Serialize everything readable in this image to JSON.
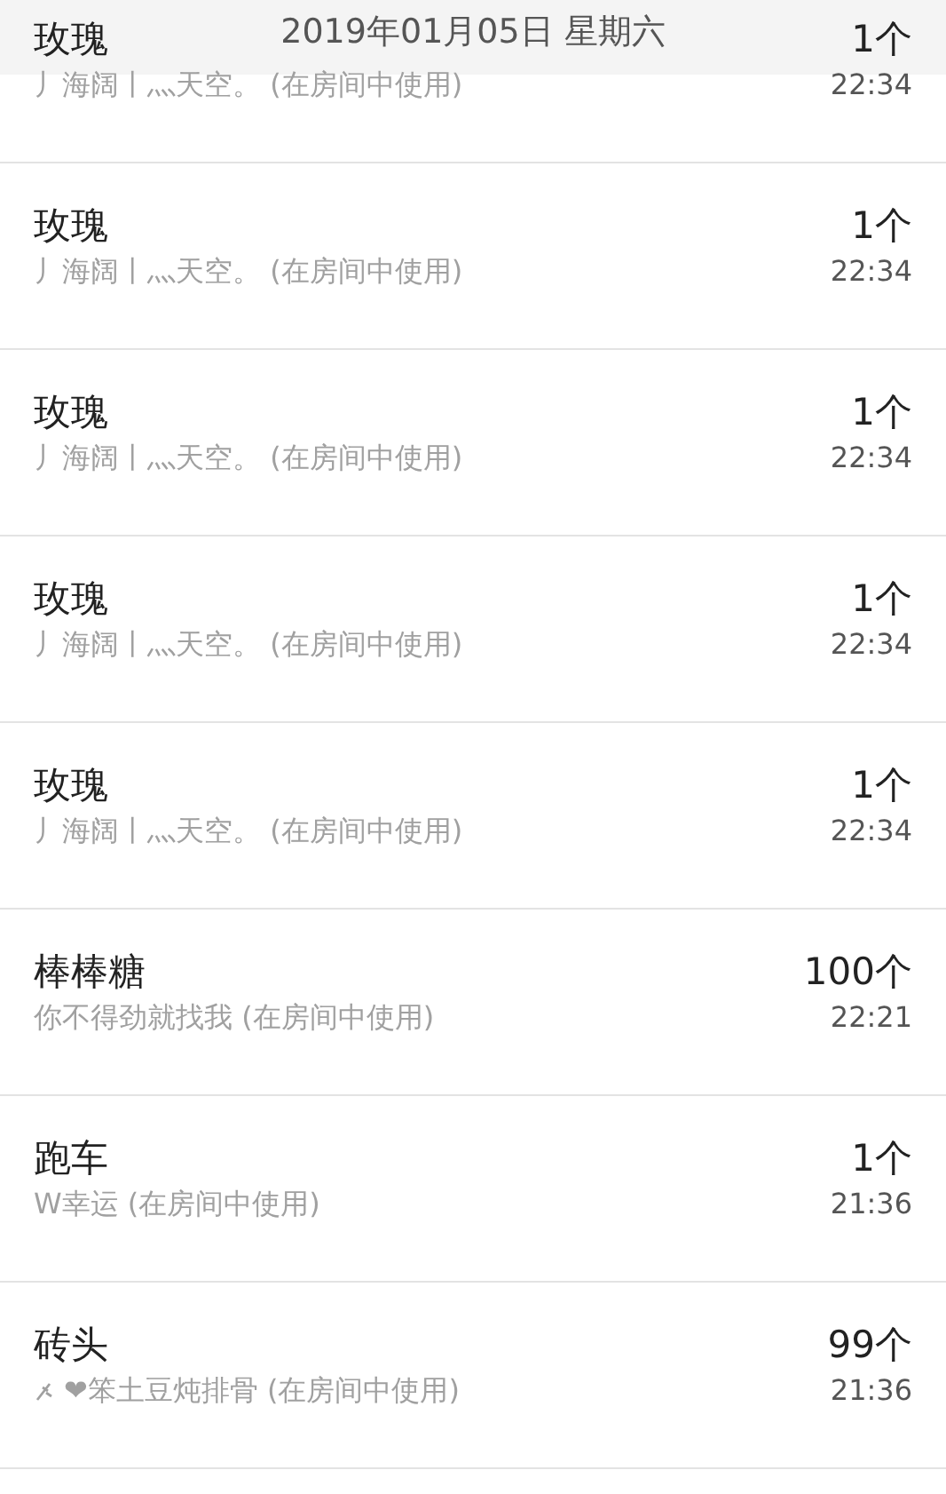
{
  "header": {
    "date": "2019年01月05日 星期六"
  },
  "records": [
    {
      "gift": "玫瑰",
      "sender": "丿海阔丨灬天空。",
      "note": "(在房间中使用)",
      "count": "1个",
      "time": "22:34"
    },
    {
      "gift": "玫瑰",
      "sender": "丿海阔丨灬天空。",
      "note": "(在房间中使用)",
      "count": "1个",
      "time": "22:34"
    },
    {
      "gift": "玫瑰",
      "sender": "丿海阔丨灬天空。",
      "note": "(在房间中使用)",
      "count": "1个",
      "time": "22:34"
    },
    {
      "gift": "玫瑰",
      "sender": "丿海阔丨灬天空。",
      "note": "(在房间中使用)",
      "count": "1个",
      "time": "22:34"
    },
    {
      "gift": "玫瑰",
      "sender": "丿海阔丨灬天空。",
      "note": "(在房间中使用)",
      "count": "1个",
      "time": "22:34"
    },
    {
      "gift": "棒棒糖",
      "sender": "你不得劲就找我",
      "note": "(在房间中使用)",
      "count": "100个",
      "time": "22:21"
    },
    {
      "gift": "跑车",
      "sender": "W幸运",
      "note": "(在房间中使用)",
      "count": "1个",
      "time": "21:36"
    },
    {
      "gift": "砖头",
      "sender": "❤笨土豆炖排骨",
      "prefix_icon": true,
      "note": "(在房间中使用)",
      "count": "99个",
      "time": "21:36"
    }
  ]
}
